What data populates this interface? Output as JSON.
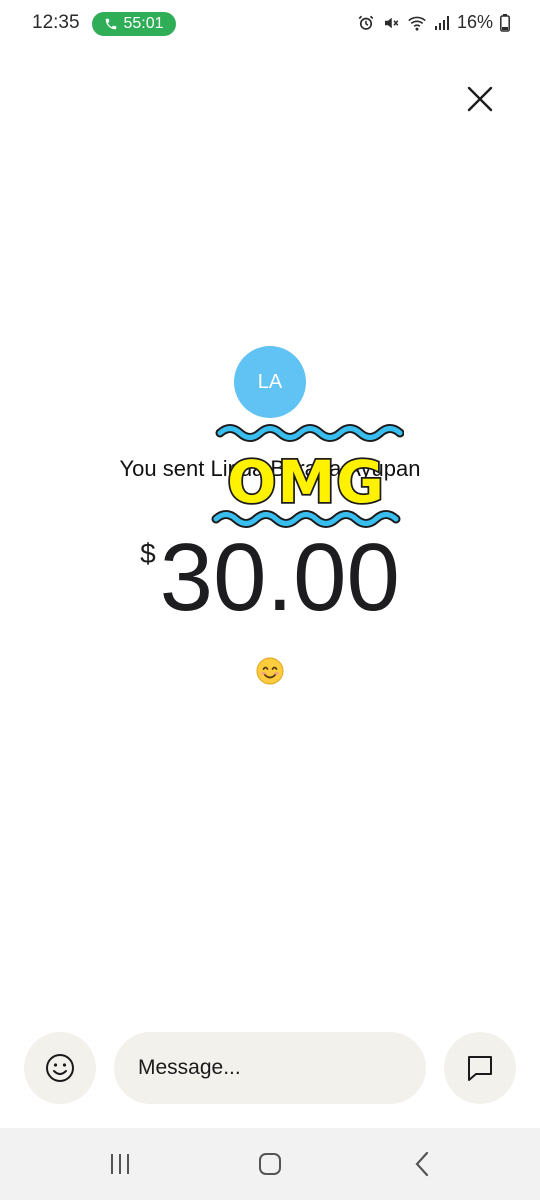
{
  "status_bar": {
    "time": "12:35",
    "call_duration": "55:01",
    "battery": "16%",
    "icons": [
      "alarm-icon",
      "mute-icon",
      "wifi-icon",
      "signal-icon",
      "battery-icon"
    ]
  },
  "recipient": {
    "initials": "LA",
    "avatar_color": "#60c3f4"
  },
  "payment": {
    "sent_text": "You sent Linda Berana Ayupan",
    "currency_symbol": "$",
    "amount": "30.00",
    "note_emoji": "smiling-face-icon"
  },
  "sticker": {
    "text": "OMG",
    "fill_color": "#fff200",
    "wave_color": "#38bff0"
  },
  "composer": {
    "placeholder": "Message..."
  },
  "colors": {
    "call_pill": "#2fae57",
    "composer_bg": "#f3f1ec"
  }
}
